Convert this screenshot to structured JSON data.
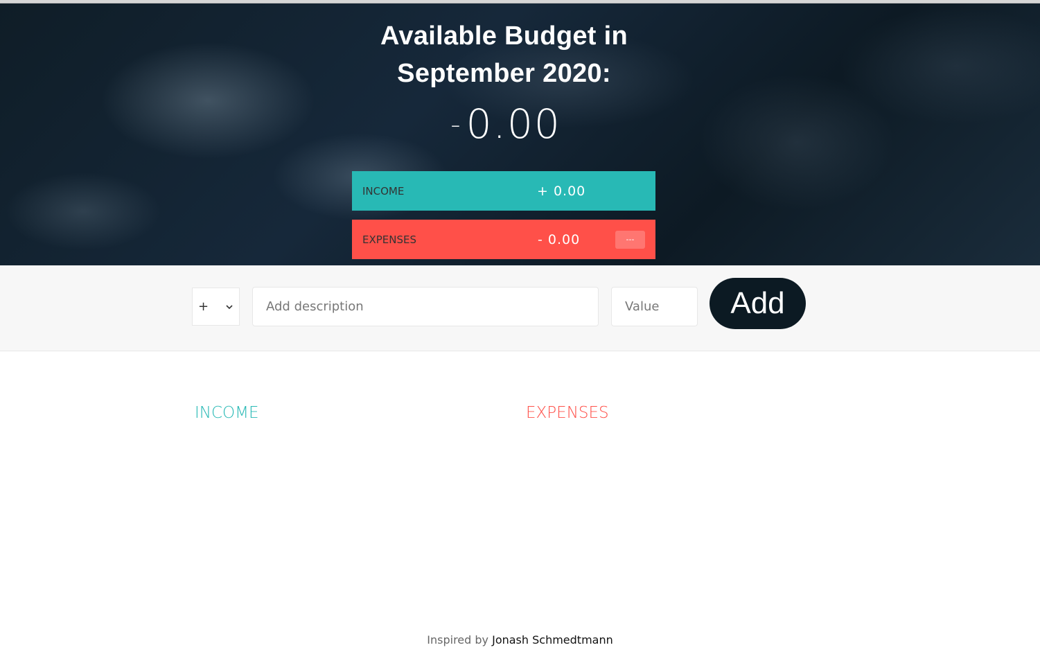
{
  "header": {
    "title_line1": "Available Budget in",
    "title_line2": "September 2020:",
    "budget_sign": "-",
    "budget_amount": "0.00"
  },
  "summary": {
    "income_label": "INCOME",
    "income_value": "+ 0.00",
    "expenses_label": "EXPENSES",
    "expenses_value": "- 0.00",
    "expenses_percentage": "---"
  },
  "add_form": {
    "type_value": "+",
    "description_placeholder": "Add description",
    "value_placeholder": "Value",
    "add_label": "Add"
  },
  "lists": {
    "income_title": "INCOME",
    "expenses_title": "EXPENSES"
  },
  "footer": {
    "prefix": "Inspired by ",
    "author": "Jonash Schmedtmann"
  },
  "colors": {
    "income": "#28b9b5",
    "expenses": "#ff5049",
    "button": "#0c1a23"
  }
}
